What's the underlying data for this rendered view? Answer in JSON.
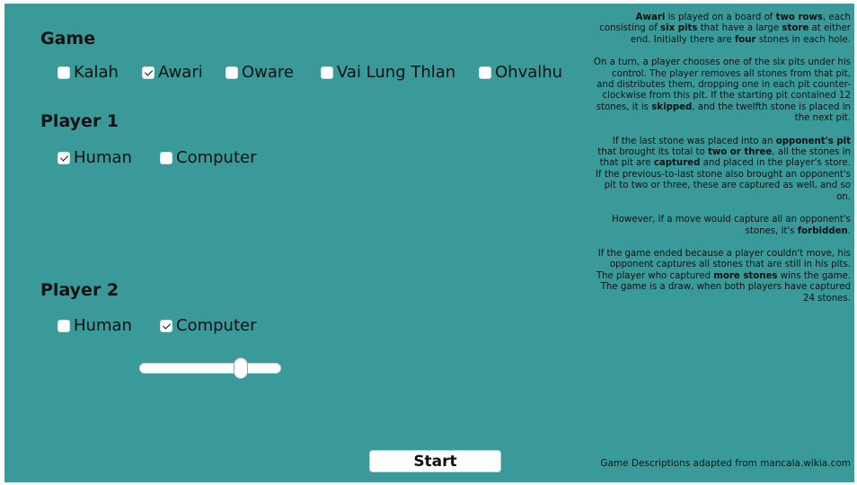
{
  "game_section": {
    "title": "Game",
    "options": [
      {
        "label": "Kalah",
        "checked": false
      },
      {
        "label": "Awari",
        "checked": true
      },
      {
        "label": "Oware",
        "checked": false
      },
      {
        "label": "Vai Lung Thlan",
        "checked": false
      },
      {
        "label": "Ohvalhu",
        "checked": false
      }
    ]
  },
  "player1": {
    "title": "Player 1",
    "options": [
      {
        "label": "Human",
        "checked": true
      },
      {
        "label": "Computer",
        "checked": false
      }
    ]
  },
  "player2": {
    "title": "Player 2",
    "options": [
      {
        "label": "Human",
        "checked": false
      },
      {
        "label": "Computer",
        "checked": true
      }
    ],
    "difficulty_level": 0.72
  },
  "description": {
    "paragraphs": [
      [
        {
          "t": "Awari",
          "b": true
        },
        {
          "t": " is played on a board of ",
          "b": false
        },
        {
          "t": "two rows",
          "b": true
        },
        {
          "t": ", each consisting of ",
          "b": false
        },
        {
          "t": "six pits",
          "b": true
        },
        {
          "t": " that have a large ",
          "b": false
        },
        {
          "t": "store",
          "b": true
        },
        {
          "t": " at either end. Initially there are ",
          "b": false
        },
        {
          "t": "four",
          "b": true
        },
        {
          "t": " stones in each hole.",
          "b": false
        }
      ],
      [
        {
          "t": "On a turn, a player chooses one of the six pits under his control. The player removes all stones from that pit, and distributes them, dropping one in each pit counter-clockwise from this pit. If the starting pit contained 12 stones, it is ",
          "b": false
        },
        {
          "t": "skipped",
          "b": true
        },
        {
          "t": ", and the twelfth stone is placed in the next pit.",
          "b": false
        }
      ],
      [
        {
          "t": "If the last stone was placed into an ",
          "b": false
        },
        {
          "t": "opponent's pit",
          "b": true
        },
        {
          "t": " that brought its total to ",
          "b": false
        },
        {
          "t": "two or three",
          "b": true
        },
        {
          "t": ", all the stones in that pit are ",
          "b": false
        },
        {
          "t": "captured",
          "b": true
        },
        {
          "t": " and placed in the player's store. If the previous-to-last stone also brought an opponent's pit to two or three, these are captured as well, and so on.",
          "b": false
        }
      ],
      [
        {
          "t": "However, if a move would capture all an opponent's stones, it's ",
          "b": false
        },
        {
          "t": "forbidden",
          "b": true
        },
        {
          "t": ".",
          "b": false
        }
      ],
      [
        {
          "t": "If the game ended because a player couldn't move, his opponent captures all stones that are still in his pits. The player who captured ",
          "b": false
        },
        {
          "t": "more stones",
          "b": true
        },
        {
          "t": " wins the game. The game is a draw, when both players have captured 24 stones.",
          "b": false
        }
      ]
    ]
  },
  "start_label": "Start",
  "credits": "Game Descriptions adapted from mancala.wikia.com"
}
